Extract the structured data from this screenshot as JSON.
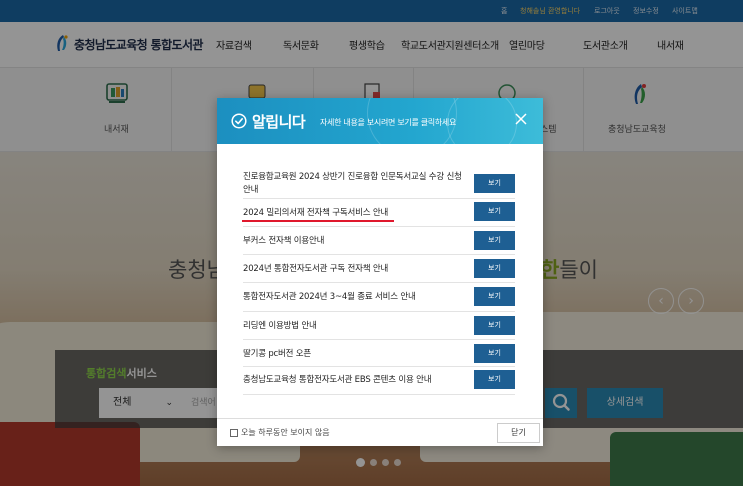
{
  "topbar": {
    "items": [
      "홈",
      "청해솔님 환영합니다",
      "로그아웃",
      "정보수정",
      "사이트맵"
    ]
  },
  "header": {
    "logo_text": "충청남도교육청 통합도서관",
    "nav": [
      "자료검색",
      "독서문화",
      "평생학습",
      "학교도서관지원센터소개",
      "열린마당",
      "도서관소개",
      "내서재"
    ]
  },
  "quick_menu": {
    "items": [
      {
        "label": "내서재",
        "icon": "bookshelf-icon"
      },
      {
        "label": "",
        "icon": "book-icon"
      },
      {
        "label": "",
        "icon": "document-icon"
      },
      {
        "label": "스템",
        "icon": "smiley-icon"
      },
      {
        "label": "충청남도교육청",
        "icon": "education-office-logo-icon"
      }
    ]
  },
  "hero": {
    "text_left": "충청남",
    "text_right_highlight": "한",
    "text_right_rest": "들이"
  },
  "search": {
    "title_highlight": "통합검색",
    "title_rest": "서비스",
    "select_value": "전체",
    "input_placeholder": "검색어",
    "detail_button": "상세검색"
  },
  "modal": {
    "title": "알립니다",
    "subtitle": "자세한 내용을 보시려면 보기를 클릭하세요",
    "notices": [
      {
        "text": "진로융합교육원 2024 상반기 진로융합 인문독서교실 수강 신청 안내",
        "button": "보기"
      },
      {
        "text": "2024 밀리의서재 전자책 구독서비스 안내",
        "button": "보기",
        "underline_color": "#e0182d"
      },
      {
        "text": "부커스 전자책 이용안내",
        "button": "보기"
      },
      {
        "text": "2024년 통합전자도서관 구독 전자책 안내",
        "button": "보기"
      },
      {
        "text": "통합전자도서관 2024년 3~4월 종료 서비스 안내",
        "button": "보기"
      },
      {
        "text": "리딩엔 이용방법 안내",
        "button": "보기"
      },
      {
        "text": "딸기콩 pc버전 오픈",
        "button": "보기"
      },
      {
        "text": "충청남도교육청 통합전자도서관 EBS 콘텐츠 이용 안내",
        "button": "보기"
      }
    ],
    "footer_checkbox_label": "오늘 하루동안 보이지 않음",
    "close_button": "닫기"
  },
  "colors": {
    "topbar": "#1a69a8",
    "modal_header": "#1c8fc0",
    "view_button": "#1e5f93",
    "search_button": "#2a8bb5",
    "highlight_underline": "#e0182d"
  }
}
